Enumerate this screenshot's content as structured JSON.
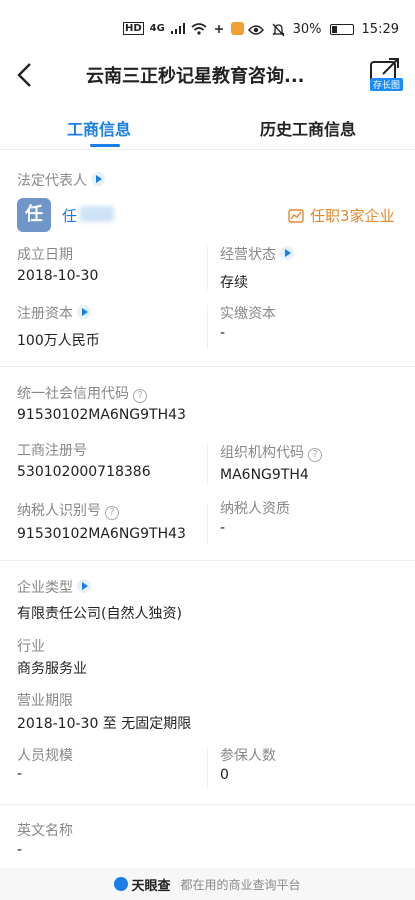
{
  "status_bar": {
    "net_badge": "HD",
    "net_type": "4G",
    "battery": "30%",
    "battery_level": 0.3,
    "time": "15:29"
  },
  "header": {
    "title": "云南三正秒记星教育咨询...",
    "share_tag": "存长图"
  },
  "tabs": [
    {
      "label": "工商信息",
      "active": true
    },
    {
      "label": "历史工商信息",
      "active": false
    }
  ],
  "legal_rep": {
    "label": "法定代表人",
    "avatar_char": "任",
    "name": "任",
    "positions": "任职3家企业"
  },
  "fields": {
    "established": {
      "label": "成立日期",
      "value": "2018-10-30"
    },
    "status": {
      "label": "经营状态",
      "value": "存续"
    },
    "reg_capital": {
      "label": "注册资本",
      "value": "100万人民币"
    },
    "paid_capital": {
      "label": "实缴资本",
      "value": "-"
    },
    "credit_code": {
      "label": "统一社会信用代码",
      "value": "91530102MA6NG9TH43"
    },
    "reg_no": {
      "label": "工商注册号",
      "value": "530102000718386"
    },
    "org_code": {
      "label": "组织机构代码",
      "value": "MA6NG9TH4"
    },
    "taxpayer_id": {
      "label": "纳税人识别号",
      "value": "91530102MA6NG9TH43"
    },
    "taxpayer_qual": {
      "label": "纳税人资质",
      "value": "-"
    },
    "company_type": {
      "label": "企业类型",
      "value": "有限责任公司(自然人独资)"
    },
    "industry": {
      "label": "行业",
      "value": "商务服务业"
    },
    "biz_term": {
      "label": "营业期限",
      "value": "2018-10-30 至 无固定期限"
    },
    "staff_size": {
      "label": "人员规模",
      "value": "-"
    },
    "insured": {
      "label": "参保人数",
      "value": "0"
    },
    "english_name": {
      "label": "英文名称",
      "value": "-"
    }
  },
  "footer": {
    "logo_text": "天眼查",
    "slogan": "都在用的商业查询平台"
  },
  "colors": {
    "accent": "#1a7ee8",
    "orange": "#e6882c"
  }
}
